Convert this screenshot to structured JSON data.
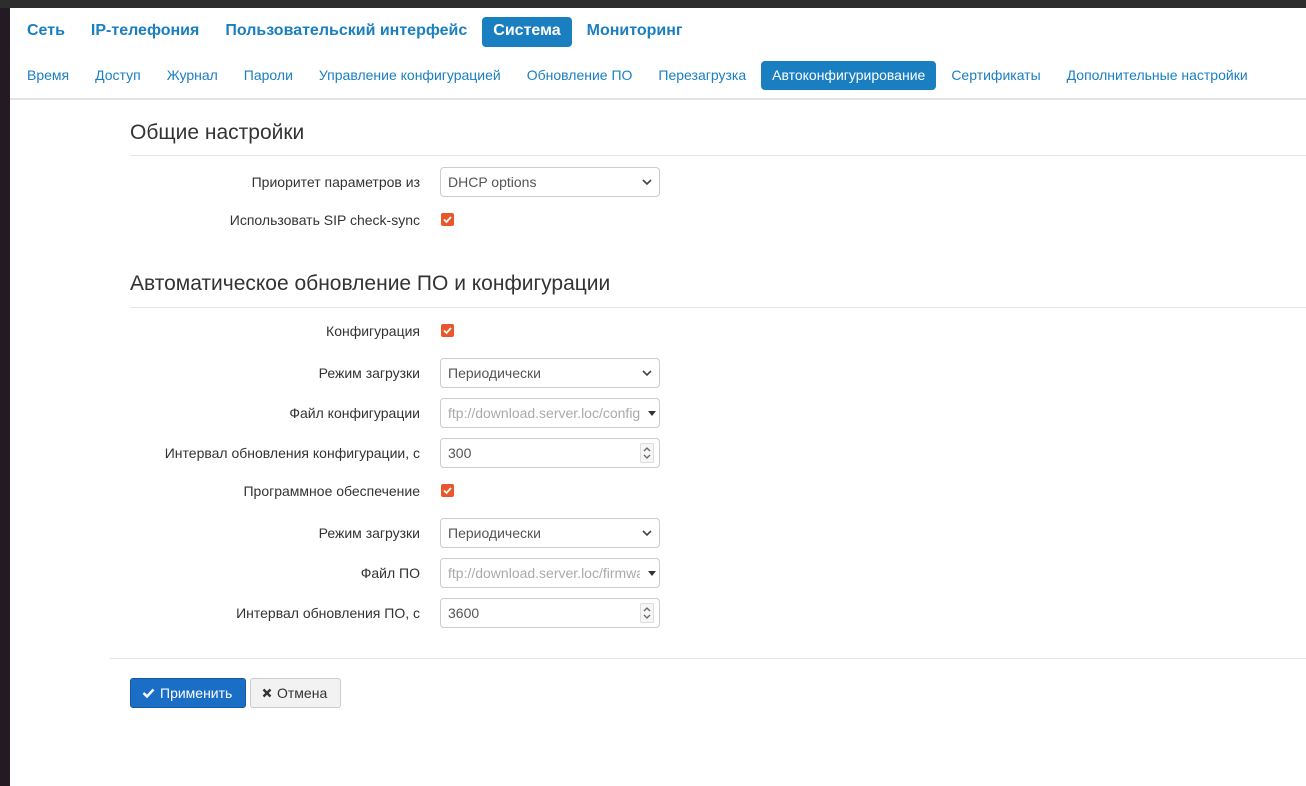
{
  "main_nav": {
    "items": [
      "Сеть",
      "IP-телефония",
      "Пользовательский интерфейс",
      "Система",
      "Мониторинг"
    ],
    "active": "Система"
  },
  "sub_nav": {
    "items": [
      "Время",
      "Доступ",
      "Журнал",
      "Пароли",
      "Управление конфигурацией",
      "Обновление ПО",
      "Перезагрузка",
      "Автоконфигурирование",
      "Сертификаты",
      "Дополнительные настройки"
    ],
    "active": "Автоконфигурирование"
  },
  "general": {
    "title": "Общие настройки",
    "priority_label": "Приоритет параметров из",
    "priority_value": "DHCP options",
    "sip_label": "Использовать SIP check-sync",
    "sip_checked": true
  },
  "auto_update": {
    "title": "Автоматическое обновление ПО и конфигурации",
    "config_label": "Конфигурация",
    "config_checked": true,
    "config_mode_label": "Режим загрузки",
    "config_mode_value": "Периодически",
    "config_file_label": "Файл конфигурации",
    "config_file_value": "ftp://download.server.loc/config",
    "config_interval_label": "Интервал обновления конфигурации, с",
    "config_interval_value": "300",
    "fw_label": "Программное обеспечение",
    "fw_checked": true,
    "fw_mode_label": "Режим загрузки",
    "fw_mode_value": "Периодически",
    "fw_file_label": "Файл ПО",
    "fw_file_value": "ftp://download.server.loc/firmware",
    "fw_interval_label": "Интервал обновления ПО, с",
    "fw_interval_value": "3600"
  },
  "actions": {
    "apply_label": "Применить",
    "cancel_label": "Отмена"
  },
  "colors": {
    "accent": "#1a7fc1",
    "checkbox": "#e8572a",
    "primary_button": "#1a6ec6"
  }
}
